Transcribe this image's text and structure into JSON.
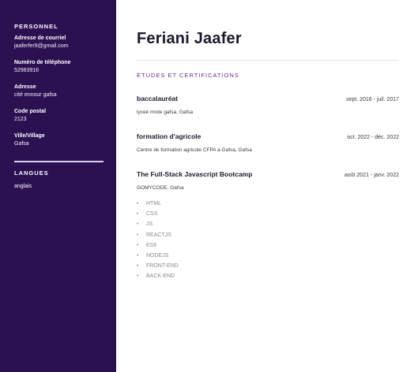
{
  "sidebar": {
    "personnel_heading": "PERSONNEL",
    "fields": [
      {
        "label": "Adresse de courriel",
        "value": "jaaferfer9@gmail.com"
      },
      {
        "label": "Numéro de téléphone",
        "value": "52983916"
      },
      {
        "label": "Adresse",
        "value": "cité ennour gafsa"
      },
      {
        "label": "Code postal",
        "value": "2123"
      },
      {
        "label": "Ville/Village",
        "value": "Gafsa"
      }
    ],
    "languages_heading": "LANGUES",
    "languages": [
      "anglais"
    ]
  },
  "main": {
    "name": "Feriani Jaafer",
    "section_title": "ÉTUDES ET CERTIFICATIONS",
    "entries": [
      {
        "title": "baccalauréat",
        "date": "sept. 2016 - juil. 2017",
        "subtitle": "lyceé mixte gafsa, Gafsa"
      },
      {
        "title": "formation d'agricole",
        "date": "oct. 2022 - déc. 2022",
        "subtitle": "Centre de formation agricole CFPA a Gafsa, Gafsa"
      },
      {
        "title": "The Full-Stack Javascript Bootcamp",
        "date": "août 2021 - janv. 2022",
        "subtitle": "GOMYCODE, Gafsa",
        "skills": [
          "HTML",
          "CSS",
          "JS",
          "REACTJS",
          "ES6",
          "NODEJS",
          "FRONT-END",
          "BACK-END"
        ]
      }
    ]
  },
  "colors": {
    "sidebar_bg": "#2c1152",
    "section_accent": "#6a2f8f"
  }
}
